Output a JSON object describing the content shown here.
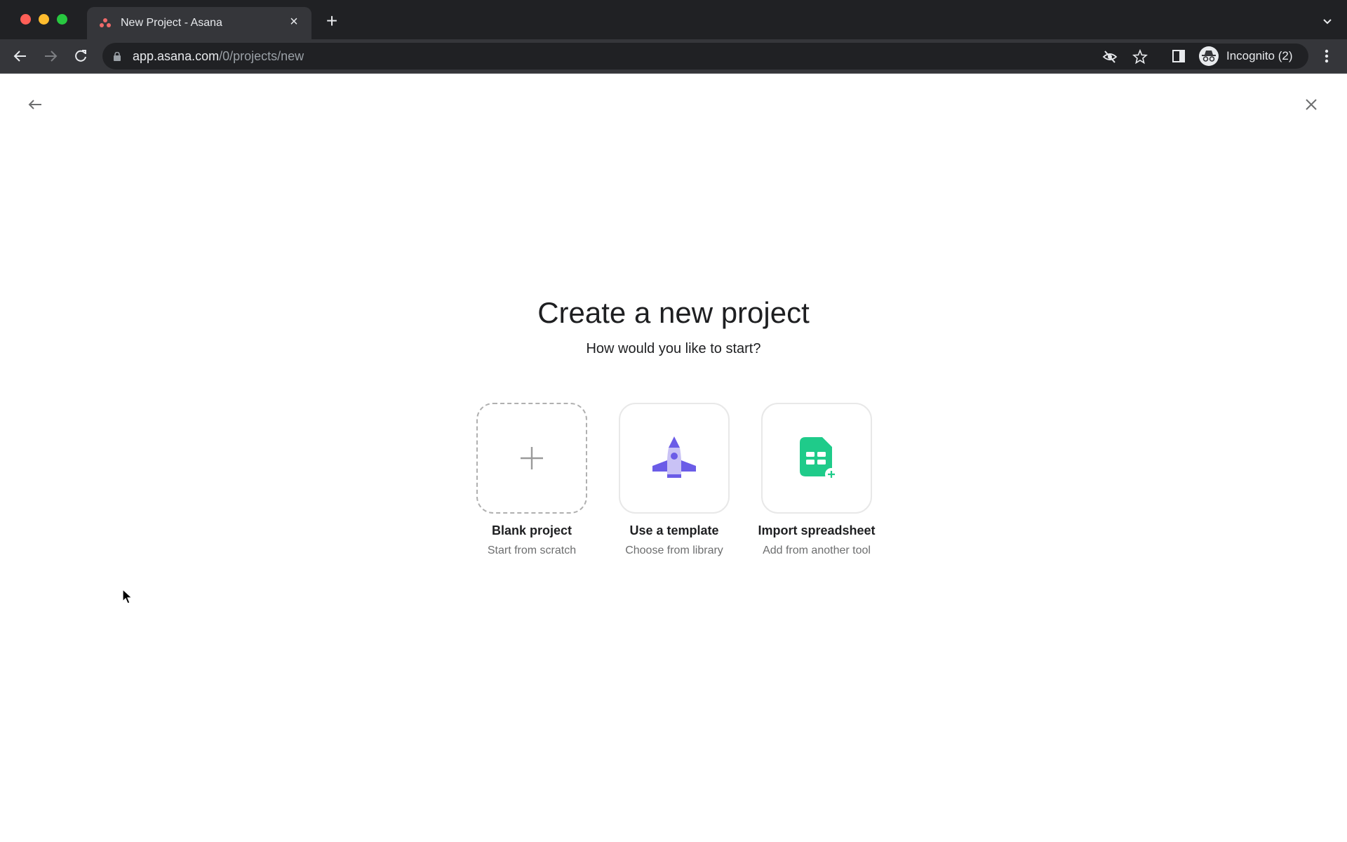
{
  "browser": {
    "tab": {
      "title": "New Project - Asana",
      "favicon": "asana-logo-icon"
    },
    "url": {
      "host": "app.asana.com",
      "path": "/0/projects/new"
    },
    "profile": {
      "label": "Incognito (2)"
    },
    "icons": [
      "back-icon",
      "forward-icon",
      "reload-icon",
      "lock-icon",
      "eye-off-icon",
      "star-icon",
      "side-panel-icon",
      "incognito-icon",
      "menu-dots-icon",
      "tab-search-icon"
    ]
  },
  "page": {
    "title": "Create a new project",
    "subtitle": "How would you like to start?",
    "options": [
      {
        "title": "Blank project",
        "description": "Start from scratch",
        "icon": "plus-icon"
      },
      {
        "title": "Use a template",
        "description": "Choose from library",
        "icon": "rocket-icon"
      },
      {
        "title": "Import spreadsheet",
        "description": "Add from another tool",
        "icon": "spreadsheet-import-icon"
      }
    ]
  },
  "colors": {
    "rocket_dark": "#6b5ce7",
    "rocket_light": "#c9c2f5",
    "spreadsheet_green": "#1fcb8a",
    "asana_coral": "#f06a6a"
  }
}
